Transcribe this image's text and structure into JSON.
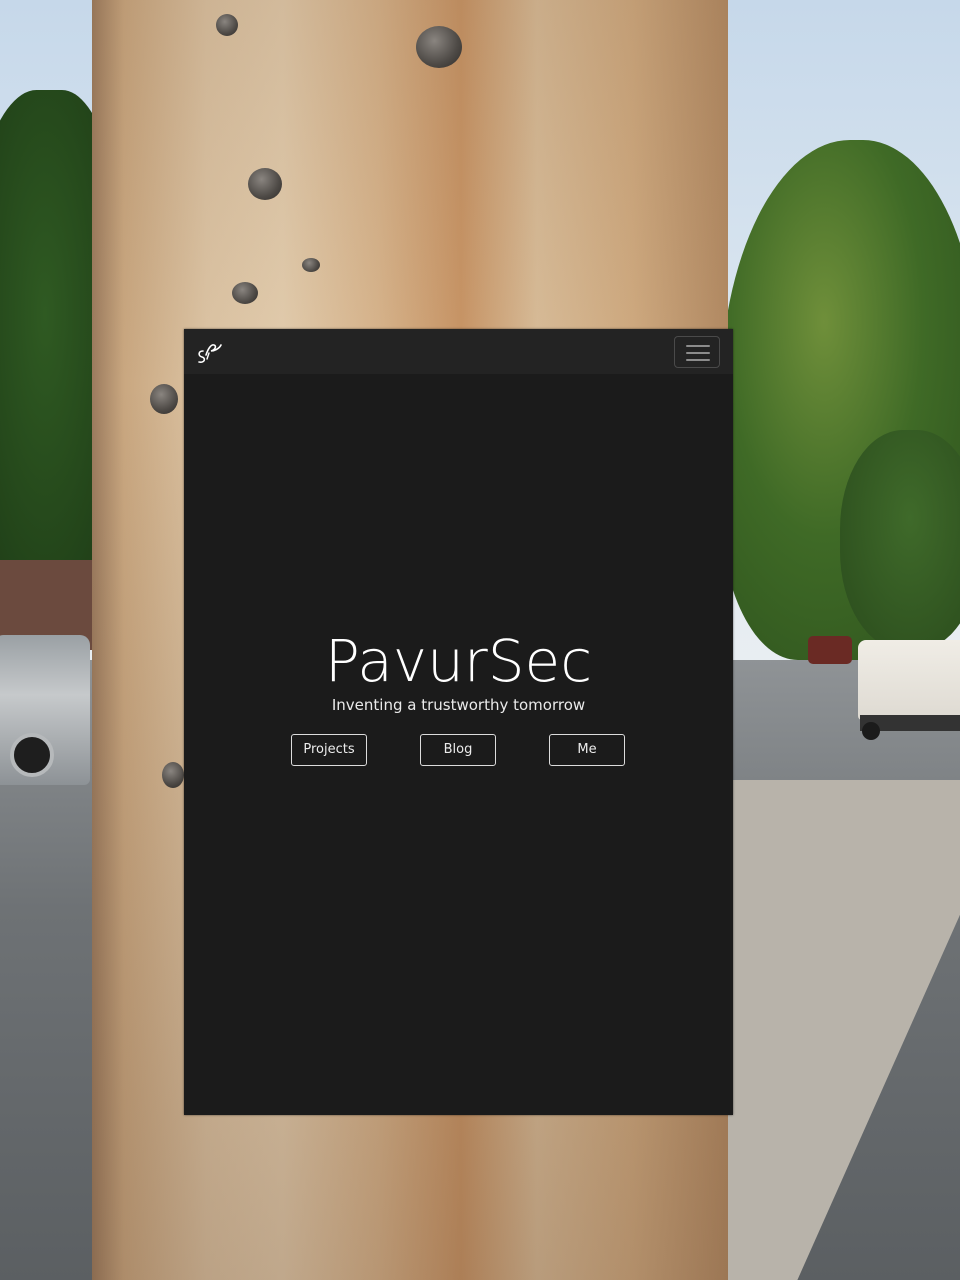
{
  "site": {
    "logo_icon": "signature-logo-icon",
    "menu_icon": "hamburger-menu-icon",
    "title": "PavurSec",
    "tagline": "Inventing a trustworthy tomorrow",
    "buttons": [
      {
        "label": "Projects"
      },
      {
        "label": "Blog"
      },
      {
        "label": "Me"
      }
    ]
  },
  "colors": {
    "page_background": "#1b1b1b",
    "navbar_background": "#232323",
    "text": "#ffffff",
    "button_border": "#dcdcdc"
  }
}
